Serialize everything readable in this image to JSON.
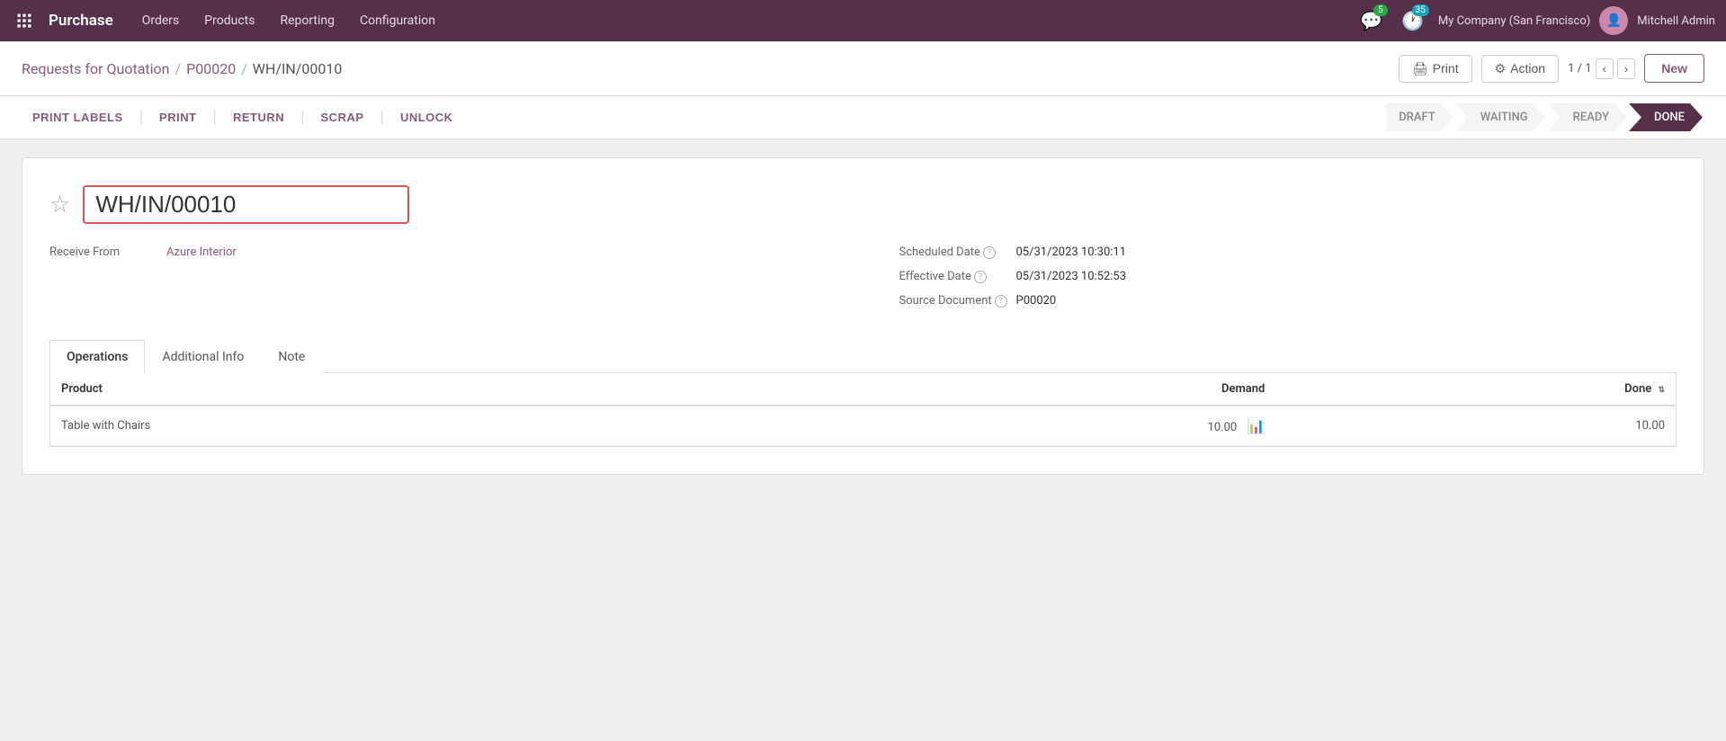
{
  "topNav": {
    "brand": "Purchase",
    "items": [
      "Orders",
      "Products",
      "Reporting",
      "Configuration"
    ],
    "messages": {
      "count": 5
    },
    "activities": {
      "count": 35
    },
    "company": "My Company (San Francisco)",
    "user": "Mitchell Admin"
  },
  "breadcrumb": {
    "parts": [
      "Requests for Quotation",
      "P00020",
      "WH/IN/00010"
    ],
    "separator": "/"
  },
  "toolbar": {
    "print_label": "PRINT LABELS",
    "print_label2": "PRINT",
    "return_label": "RETURN",
    "scrap_label": "SCRAP",
    "unlock_label": "UNLOCK",
    "print_btn": "Print",
    "action_btn": "Action",
    "page_info": "1 / 1",
    "new_btn": "New"
  },
  "statusPipeline": {
    "steps": [
      "DRAFT",
      "WAITING",
      "READY",
      "DONE"
    ],
    "active": "DONE"
  },
  "form": {
    "title": "WH/IN/00010",
    "receiveFrom": {
      "label": "Receive From",
      "value": "Azure Interior"
    },
    "scheduledDate": {
      "label": "Scheduled Date",
      "help": "?",
      "value": "05/31/2023 10:30:11"
    },
    "effectiveDate": {
      "label": "Effective Date",
      "help": "?",
      "value": "05/31/2023 10:52:53"
    },
    "sourceDocument": {
      "label": "Source Document",
      "help": "?",
      "value": "P00020"
    }
  },
  "tabs": [
    {
      "id": "operations",
      "label": "Operations",
      "active": true
    },
    {
      "id": "additional-info",
      "label": "Additional Info",
      "active": false
    },
    {
      "id": "note",
      "label": "Note",
      "active": false
    }
  ],
  "table": {
    "columns": [
      {
        "id": "product",
        "label": "Product",
        "align": "left"
      },
      {
        "id": "demand",
        "label": "Demand",
        "align": "right"
      },
      {
        "id": "done",
        "label": "Done",
        "align": "right",
        "sortable": true
      }
    ],
    "rows": [
      {
        "product": "Table with Chairs",
        "demand": "10.00",
        "done": "10.00"
      }
    ]
  }
}
